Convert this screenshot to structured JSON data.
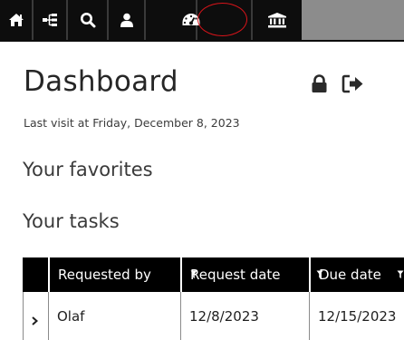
{
  "toolbar": {
    "items": [
      {
        "name": "home-icon"
      },
      {
        "name": "hierarchy-icon"
      },
      {
        "name": "search-icon"
      },
      {
        "name": "user-icon"
      },
      {
        "name": "dashboard-icon",
        "highlighted": true
      },
      {
        "name": "bank-icon"
      }
    ],
    "highlight_color": "#d8141a"
  },
  "page": {
    "title": "Dashboard",
    "last_visit": "Last visit at Friday, December 8, 2023",
    "icons": [
      "lock-icon",
      "sign-out-icon"
    ]
  },
  "favorites": {
    "title": "Your favorites"
  },
  "tasks": {
    "title": "Your tasks",
    "columns": [
      {
        "label": "Requested by"
      },
      {
        "label": "Request date"
      },
      {
        "label": "Due date"
      }
    ],
    "rows": [
      {
        "requested_by": "Olaf",
        "request_date": "12/8/2023",
        "due_date": "12/15/2023"
      }
    ]
  }
}
